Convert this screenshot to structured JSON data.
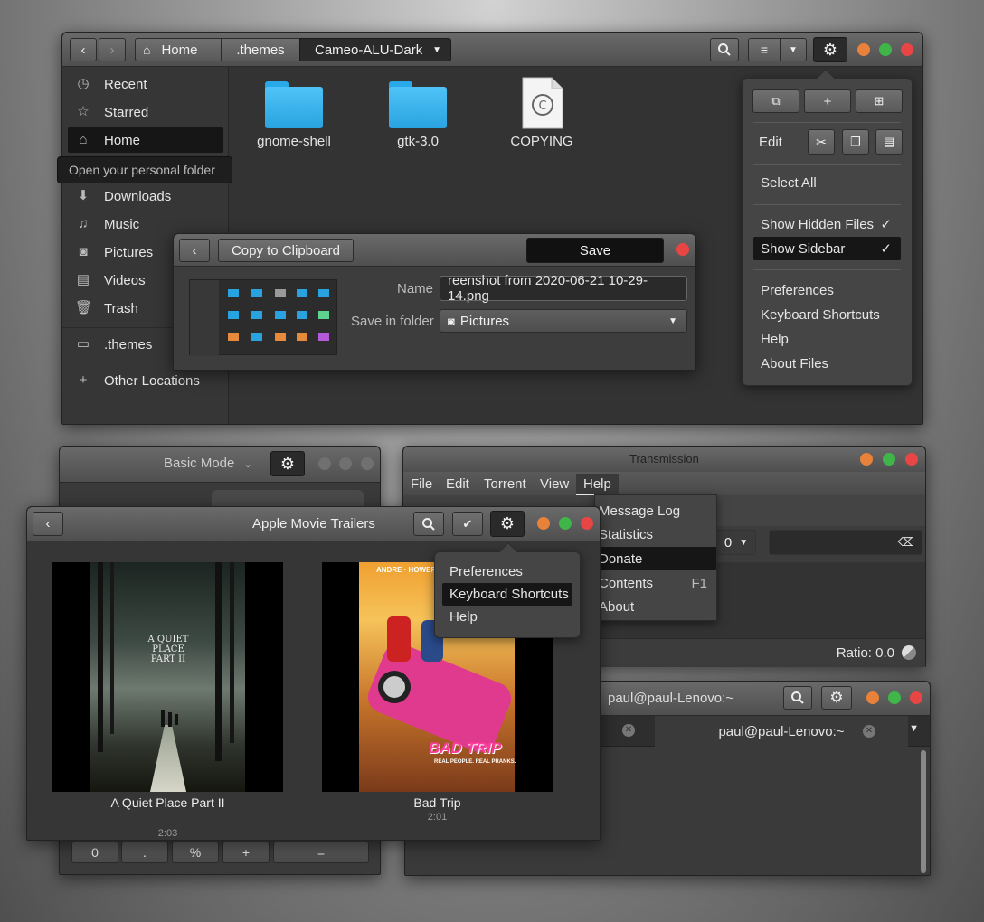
{
  "files": {
    "breadcrumb": [
      "Home",
      ".themes",
      "Cameo-ALU-Dark"
    ],
    "sidebar": [
      {
        "label": "Recent",
        "icon": "clock-icon"
      },
      {
        "label": "Starred",
        "icon": "star-icon"
      },
      {
        "label": "Home",
        "icon": "home-icon"
      },
      {
        "label": "Downloads",
        "icon": "download-icon"
      },
      {
        "label": "Music",
        "icon": "music-icon"
      },
      {
        "label": "Pictures",
        "icon": "camera-icon"
      },
      {
        "label": "Videos",
        "icon": "film-icon"
      },
      {
        "label": "Trash",
        "icon": "trash-icon"
      },
      {
        "label": ".themes",
        "icon": "folder-icon"
      },
      {
        "label": "Other Locations",
        "icon": "plus-icon"
      }
    ],
    "tooltip": "Open your personal folder",
    "items": [
      "gnome-shell",
      "gtk-3.0",
      "COPYING"
    ],
    "menu": {
      "edit": "Edit",
      "select_all": "Select All",
      "show_hidden": "Show Hidden Files",
      "show_sidebar": "Show Sidebar",
      "check": "✓",
      "preferences": "Preferences",
      "shortcuts": "Keyboard Shortcuts",
      "help": "Help",
      "about": "About Files"
    }
  },
  "screenshot": {
    "copy": "Copy to Clipboard",
    "save": "Save",
    "name_label": "Name",
    "name_value": "reenshot from 2020-06-21 10-29-14.png",
    "folder_label": "Save in folder",
    "folder_value": "Pictures"
  },
  "calculator": {
    "mode": "Basic Mode",
    "buttons": [
      "0",
      ".",
      "%",
      "+",
      "="
    ]
  },
  "transmission": {
    "title": "Transmission",
    "menubar": [
      "File",
      "Edit",
      "Torrent",
      "View",
      "Help"
    ],
    "help_menu": [
      {
        "label": "Message Log",
        "accel": ""
      },
      {
        "label": "Statistics",
        "accel": ""
      },
      {
        "label": "Donate",
        "accel": ""
      },
      {
        "label": "Contents",
        "accel": "F1"
      },
      {
        "label": "About",
        "accel": ""
      }
    ],
    "filter_count": "0",
    "ratio": "Ratio: 0.0"
  },
  "terminal": {
    "title": "paul@paul-Lenovo:~",
    "tab": "paul@paul-Lenovo:~"
  },
  "trailers": {
    "title": "Apple Movie Trailers",
    "menu": [
      "Preferences",
      "Keyboard Shortcuts",
      "Help"
    ],
    "movies": [
      {
        "title": "A Quiet Place Part II",
        "duration": "2:03",
        "poster_text": "A QUIET PLACE PART II"
      },
      {
        "title": "Bad Trip",
        "duration": "2:01",
        "poster_text": "BAD TRIP",
        "poster_tagline": "REAL PEOPLE. REAL PRANKS.",
        "poster_top": "ANDRE · HOWERY"
      }
    ]
  },
  "colors": {
    "accent_selected": "#161616",
    "folder": "#29a3e0",
    "close": "#e84545",
    "minimize": "#e8823b",
    "maximize": "#3fb54a"
  }
}
